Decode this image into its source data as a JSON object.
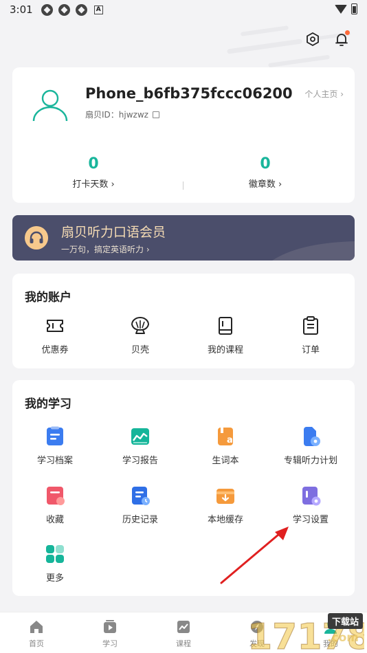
{
  "status_bar": {
    "time": "3:01",
    "mini_label": "A"
  },
  "profile": {
    "username": "Phone_b6fb375fccc06200",
    "id_label": "扇贝ID：hjwzwz",
    "homepage_link": "个人主页 ›",
    "stats": [
      {
        "value": "0",
        "label": "打卡天数 ›"
      },
      {
        "value": "0",
        "label": "徽章数 ›"
      }
    ]
  },
  "vip_banner": {
    "title": "扇贝听力口语会员",
    "subtitle": "一万句，搞定英语听力 ›"
  },
  "account": {
    "title": "我的账户",
    "items": [
      {
        "label": "优惠券",
        "icon": "ticket-icon"
      },
      {
        "label": "贝壳",
        "icon": "shell-icon"
      },
      {
        "label": "我的课程",
        "icon": "book-icon"
      },
      {
        "label": "订单",
        "icon": "clipboard-icon"
      }
    ]
  },
  "learning": {
    "title": "我的学习",
    "items": [
      {
        "label": "学习档案",
        "icon": "archive-icon"
      },
      {
        "label": "学习报告",
        "icon": "report-icon"
      },
      {
        "label": "生词本",
        "icon": "wordbook-icon"
      },
      {
        "label": "专辑听力计划",
        "icon": "listening-plan-icon"
      },
      {
        "label": "收藏",
        "icon": "favorites-icon"
      },
      {
        "label": "历史记录",
        "icon": "history-icon"
      },
      {
        "label": "本地缓存",
        "icon": "cache-icon"
      },
      {
        "label": "学习设置",
        "icon": "settings-icon"
      },
      {
        "label": "更多",
        "icon": "more-icon"
      }
    ]
  },
  "tabbar": {
    "items": [
      {
        "label": "首页",
        "icon": "home-icon"
      },
      {
        "label": "学习",
        "icon": "play-icon"
      },
      {
        "label": "课程",
        "icon": "chart-icon"
      },
      {
        "label": "发现",
        "icon": "compass-icon"
      },
      {
        "label": "我的",
        "icon": "profile-icon"
      }
    ]
  },
  "watermark": {
    "text": "17178",
    "badge": "下载站",
    "domain": ".com"
  },
  "colors": {
    "accent": "#19b59b",
    "vip_bg": "#4b4e6b",
    "vip_text": "#f6dcb4",
    "notification": "#ff6a3a",
    "arrow": "#e02020"
  }
}
